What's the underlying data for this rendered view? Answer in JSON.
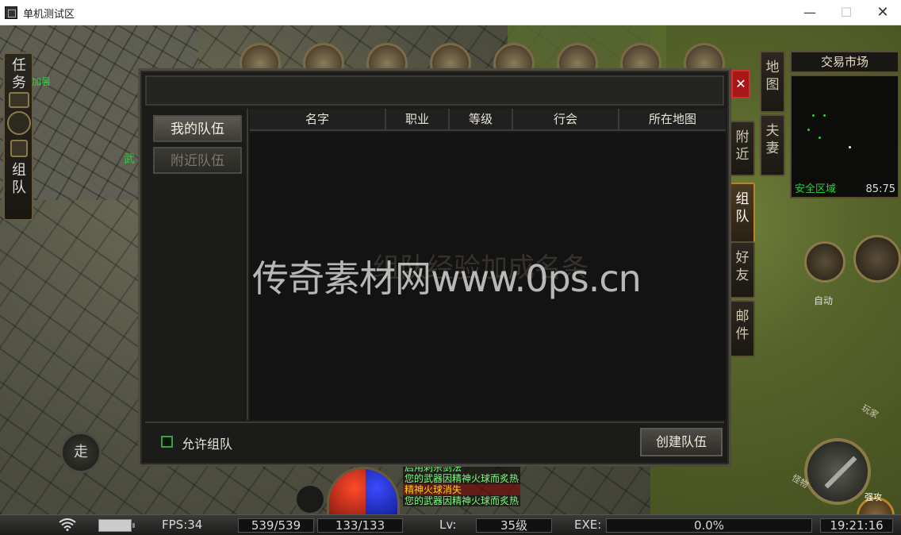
{
  "window": {
    "title": "单机测试区",
    "minimize": "—",
    "maximize": "☐",
    "close": "✕"
  },
  "left_panel": {
    "quest_label": "任务",
    "team_label": "组队",
    "buff_text": "加暑",
    "side_text": "武"
  },
  "right_panel": {
    "tabs": [
      "地图",
      "夫妻"
    ],
    "social_tabs": [
      {
        "label": "附近",
        "active": false
      },
      {
        "label": "组队",
        "active": true
      },
      {
        "label": "好友",
        "active": false
      },
      {
        "label": "邮件",
        "active": false
      }
    ],
    "map_name": "交易市场",
    "safe_zone": "安全区域",
    "coords": "85:75",
    "auto_label": "自动",
    "player_label": "玩家",
    "monster_label": "怪物",
    "strong_attack_label": "强攻"
  },
  "walk_button": "走",
  "dialog": {
    "close": "✕",
    "tabs": [
      {
        "label": "我的队伍",
        "active": true
      },
      {
        "label": "附近队伍",
        "active": false
      }
    ],
    "columns": [
      "名字",
      "职业",
      "等级",
      "行会",
      "所在地图"
    ],
    "allow_team_label": "允许组队",
    "allow_team_checked": false,
    "create_button": "创建队伍"
  },
  "watermark": "传奇素材网www.0ps.cn",
  "watermark_ghost": "组队经验加成名条",
  "chat": [
    {
      "text": "启用刺杀剑法",
      "color": "#7CFC7C"
    },
    {
      "text": "您的武器因精神火球而炙热",
      "color": "#7CFC7C"
    },
    {
      "text": "精神火球消失",
      "color": "#FFD700"
    },
    {
      "text": "您的武器因精神火球而炙热",
      "color": "#7CFC7C"
    }
  ],
  "status_bar": {
    "fps": "FPS:34",
    "hp": "539/539",
    "mp": "133/133",
    "level_label": "Lv:",
    "level": "35级",
    "exp_label": "EXE:",
    "exp": "0.0%",
    "exp_fraction": 0.0,
    "time": "19:21:16"
  }
}
